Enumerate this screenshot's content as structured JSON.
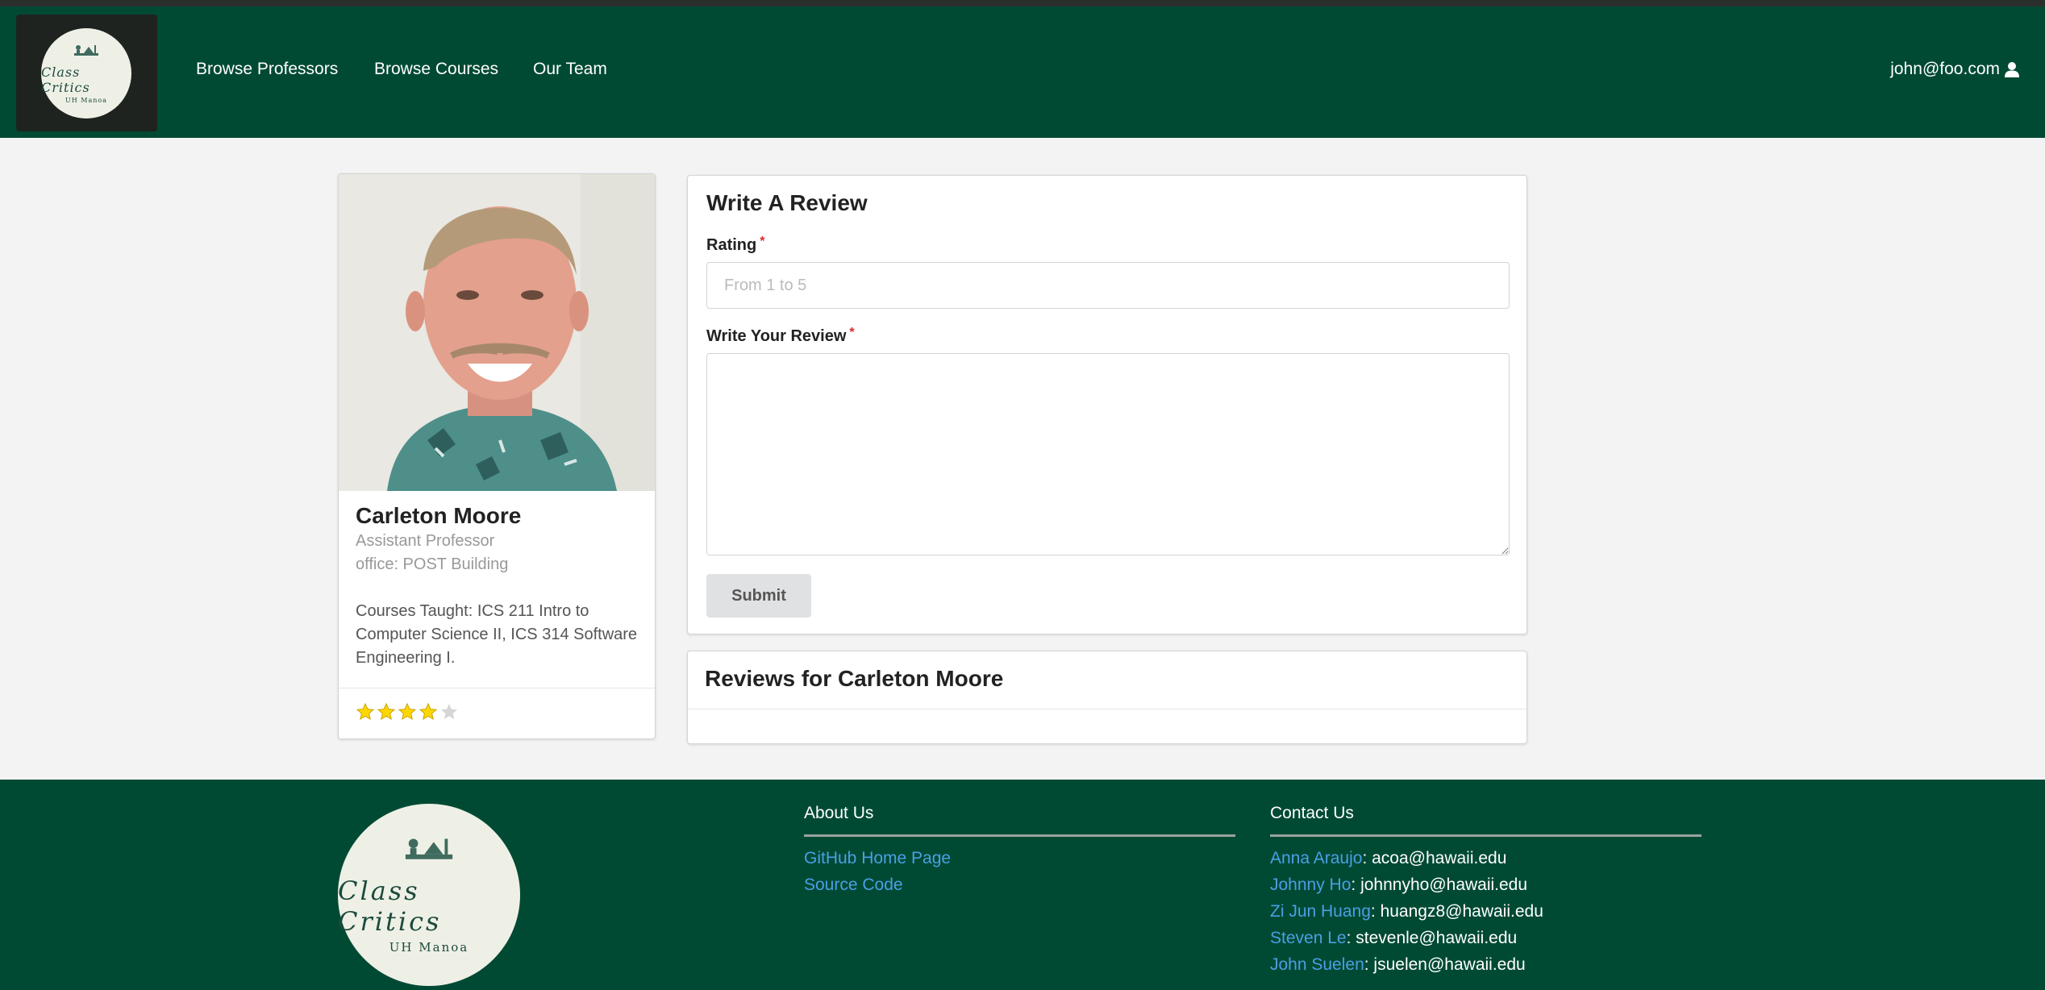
{
  "navbar": {
    "logo": {
      "title": "Class Critics",
      "subtitle": "UH Manoa"
    },
    "links": [
      "Browse Professors",
      "Browse Courses",
      "Our Team"
    ],
    "user_email": "john@foo.com"
  },
  "professor": {
    "name": "Carleton Moore",
    "title": "Assistant Professor",
    "office": "office: POST Building",
    "courses": "Courses Taught: ICS 211 Intro to Computer Science II, ICS 314 Software Engineering I.",
    "rating": 4,
    "rating_max": 5,
    "star_color": "#ffd700"
  },
  "review_form": {
    "title": "Write A Review",
    "rating_label": "Rating",
    "rating_placeholder": "From 1 to 5",
    "review_label": "Write Your Review",
    "required_mark": "*",
    "submit_label": "Submit"
  },
  "reviews_section": {
    "title": "Reviews for Carleton Moore"
  },
  "footer": {
    "logo": {
      "title": "Class Critics",
      "subtitle": "UH Manoa"
    },
    "about": {
      "heading": "About Us",
      "links": [
        "GitHub Home Page",
        "Source Code"
      ]
    },
    "contact": {
      "heading": "Contact Us",
      "people": [
        {
          "name": "Anna Araujo",
          "email": ": acoa@hawaii.edu"
        },
        {
          "name": "Johnny Ho",
          "email": ": johnnyho@hawaii.edu"
        },
        {
          "name": "Zi Jun Huang",
          "email": ": huangz8@hawaii.edu"
        },
        {
          "name": "Steven Le",
          "email": ": stevenle@hawaii.edu"
        },
        {
          "name": "John Suelen",
          "email": ": jsuelen@hawaii.edu"
        }
      ]
    }
  },
  "colors": {
    "brand_green": "#004a34",
    "link_blue": "#4b9fe3",
    "required_red": "#db2828"
  }
}
